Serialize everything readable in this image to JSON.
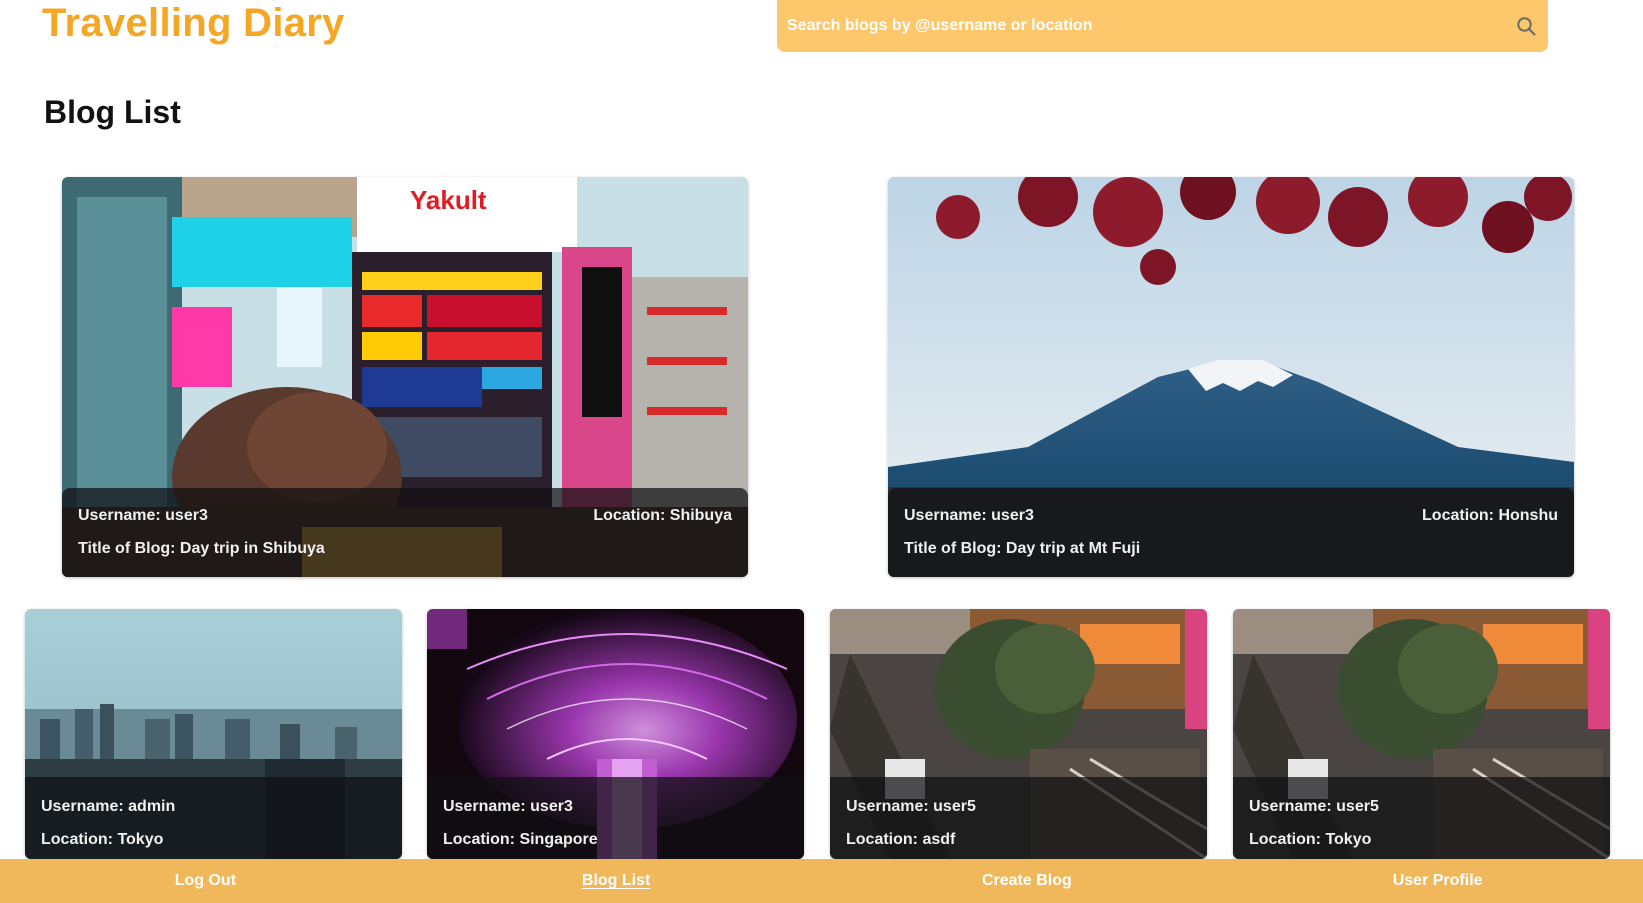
{
  "app": {
    "title": "Travelling Diary"
  },
  "search": {
    "placeholder": "Search blogs by @username or location"
  },
  "page": {
    "title": "Blog List"
  },
  "featured": [
    {
      "username": "Username: user3",
      "location": "Location: Shibuya",
      "title": "Title of Blog: Day trip in Shibuya"
    },
    {
      "username": "Username: user3",
      "location": "Location: Honshu",
      "title": "Title of Blog: Day trip at Mt Fuji"
    }
  ],
  "cards": [
    {
      "username": "Username: admin",
      "location": "Location: Tokyo"
    },
    {
      "username": "Username: user3",
      "location": "Location: Singapore"
    },
    {
      "username": "Username: user5",
      "location": "Location: asdf"
    },
    {
      "username": "Username: user5",
      "location": "Location: Tokyo"
    }
  ],
  "nav": [
    {
      "label": "Log Out",
      "active": false
    },
    {
      "label": "Blog List",
      "active": true
    },
    {
      "label": "Create Blog",
      "active": false
    },
    {
      "label": "User Profile",
      "active": false
    }
  ],
  "colors": {
    "brand": "#f5a623",
    "search_bg": "#fdc76b",
    "nav_bg": "#f0b85a"
  },
  "icons": {
    "search": "search-icon"
  }
}
